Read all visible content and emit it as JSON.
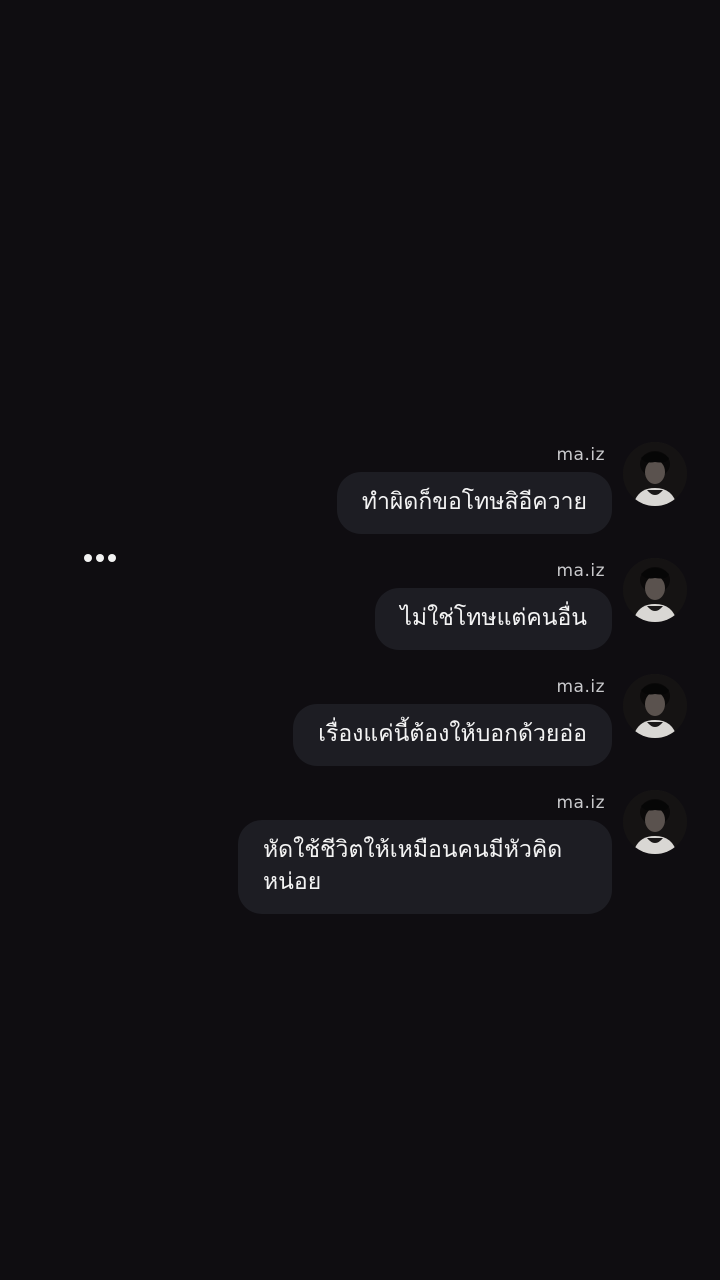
{
  "chat": {
    "typing_indicator": "•••",
    "messages": [
      {
        "sender": "ma.iz",
        "text": "ทำผิดก็ขอโทษสิอีควาย"
      },
      {
        "sender": "ma.iz",
        "text": "ไม่ใช่โทษแต่คนอื่น"
      },
      {
        "sender": "ma.iz",
        "text": "เรื่องแค่นี้ต้องให้บอกด้วยอ่อ"
      },
      {
        "sender": "ma.iz",
        "text": "หัดใช้ชีวิตให้เหมือนคนมีหัวคิดหน่อย"
      }
    ]
  },
  "theme": {
    "background": "#0f0d11",
    "bubble": "#1d1d23",
    "text": "#f4f4f4",
    "sender_text": "#c9c9cc"
  },
  "icons": {
    "avatar": "profile-photo-avatar",
    "typing": "typing-dots-icon"
  }
}
